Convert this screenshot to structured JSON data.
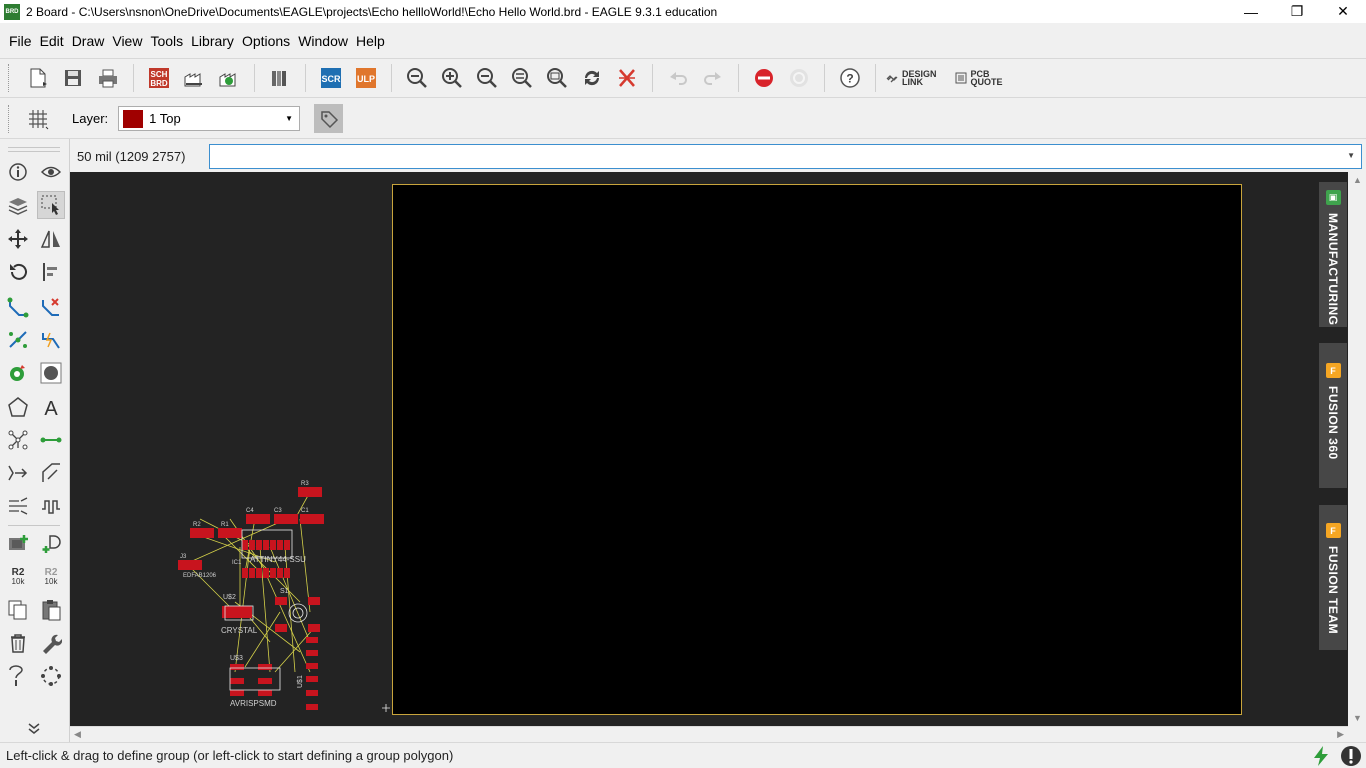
{
  "window": {
    "title": "2 Board - C:\\Users\\nsnon\\OneDrive\\Documents\\EAGLE\\projects\\Echo hellloWorld!\\Echo Hello World.brd - EAGLE 9.3.1 education",
    "app_icon": "BRD",
    "minimize": "—",
    "restore": "❐",
    "close": "✕"
  },
  "menu": [
    "File",
    "Edit",
    "Draw",
    "View",
    "Tools",
    "Library",
    "Options",
    "Window",
    "Help"
  ],
  "toolbar": {
    "sch_brd": [
      "SCH",
      "BRD"
    ],
    "scr": "SCR",
    "ulp": "ULP",
    "design_link": [
      "DESIGN",
      "LINK"
    ],
    "pcb_quote": [
      "PCB",
      "QUOTE"
    ],
    "help": "?"
  },
  "layerbar": {
    "label": "Layer:",
    "selected": "1 Top",
    "layer_color": "#a00000"
  },
  "command": {
    "coordinates": "50 mil (1209 2757)",
    "value": ""
  },
  "left_tools": {
    "value_label": "R2",
    "value_sub": "10k",
    "value_label2": "R2",
    "value_sub2": "10k",
    "value_label2_color": "#9a9a9a"
  },
  "side_panels": [
    {
      "label": "MANUFACTURING",
      "badge": "▣",
      "badge_color": "#3fa34d"
    },
    {
      "label": "FUSION 360",
      "badge": "F",
      "badge_color": "#f5a623"
    },
    {
      "label": "FUSION TEAM",
      "badge": "F",
      "badge_color": "#f5a623"
    }
  ],
  "parts": {
    "labels": [
      "R3",
      "C4",
      "C3",
      "C1",
      "R2",
      "R1",
      "IC1",
      "ATTINY44-SSU",
      "J3",
      "EDFAB1206",
      "U$2",
      "S1",
      "CRYSTAL",
      "U$3",
      "U$1",
      "AVRISPSMD"
    ],
    "pad_color": "#c8141e",
    "ratsnest_color": "#d6d24a"
  },
  "status": {
    "text": "Left-click & drag to define group (or left-click to start defining a group polygon)"
  }
}
